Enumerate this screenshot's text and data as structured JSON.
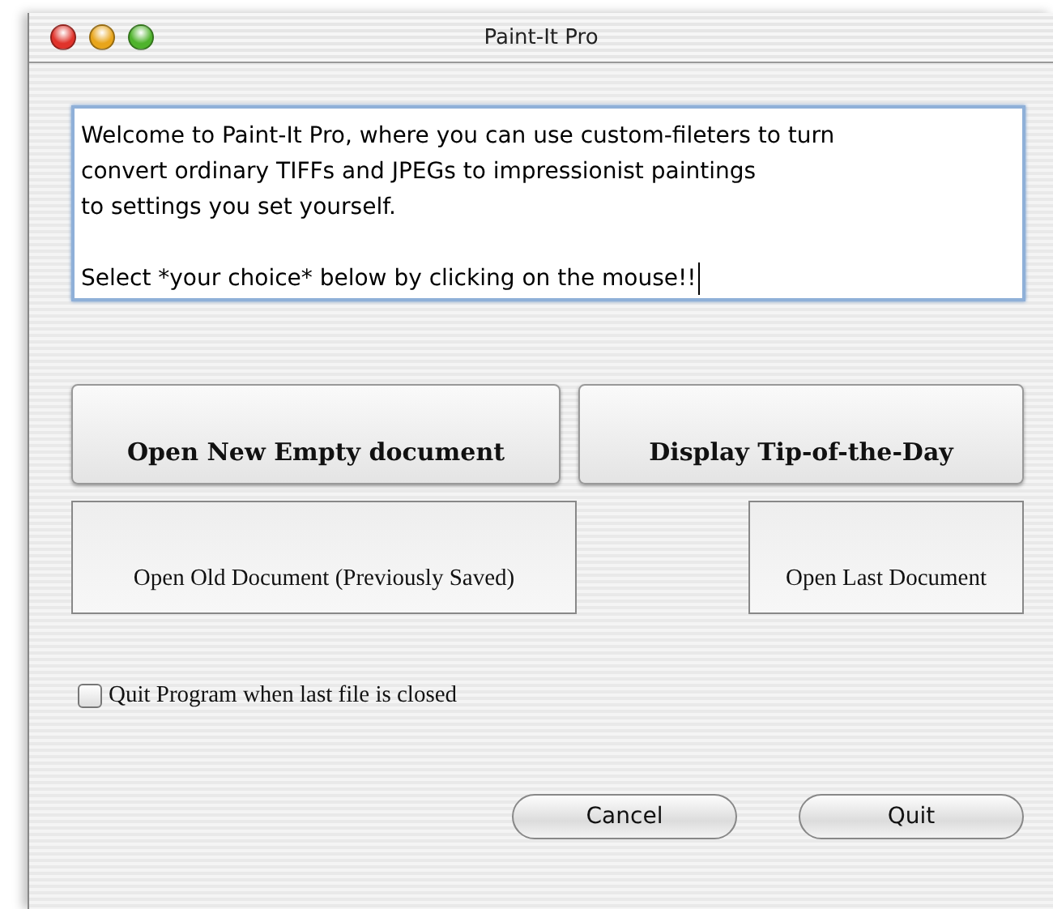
{
  "window": {
    "title": "Paint-It Pro"
  },
  "message": {
    "paragraphs": [
      [
        "Welcome to Paint-It Pro, where you can use custom-fileters to turn",
        "convert ordinary TIFFs and JPEGs to impressionist paintings",
        "to settings you set yourself."
      ],
      [
        "Select *your choice* below by clicking on the mouse!!"
      ]
    ],
    "caret": true
  },
  "action_buttons": [
    {
      "label": "Open New Empty document",
      "kind": "bevel"
    },
    {
      "label": "Display Tip-of-the-Day",
      "kind": "bevel"
    },
    {
      "label": "Open Old Document (Previously Saved)",
      "kind": "square"
    },
    {
      "label": "Open Last Document",
      "kind": "square"
    }
  ],
  "checkbox": {
    "label": "Quit Program when last file is closed",
    "checked": false
  },
  "buttons": [
    "Cancel",
    "Quit"
  ]
}
